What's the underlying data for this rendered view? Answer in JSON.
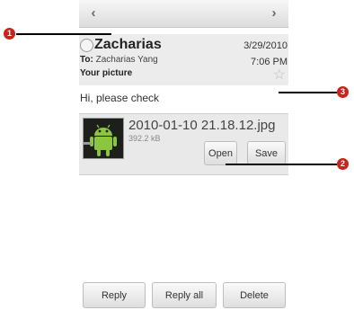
{
  "nav": {
    "prev_arrow": "‹",
    "next_arrow": "›"
  },
  "message": {
    "sender": "Zacharias",
    "date": "3/29/2010",
    "to_label": "To:",
    "to_value": "Zacharias Yang",
    "time": "7:06 PM",
    "subject": "Your picture",
    "star_icon": "☆",
    "body": "Hi, please check"
  },
  "attachment": {
    "file_name": "2010-01-10 21.18.12.jpg",
    "file_size": "392.2 kB",
    "open_label": "Open",
    "save_label": "Save"
  },
  "actions": {
    "reply_label": "Reply",
    "reply_all_label": "Reply all",
    "delete_label": "Delete"
  },
  "callouts": {
    "one": "1",
    "two": "2",
    "three": "3"
  },
  "colors": {
    "callout": "#c8241c",
    "header_bg": "#ececec",
    "attachment_bg": "#e9e9e9"
  }
}
